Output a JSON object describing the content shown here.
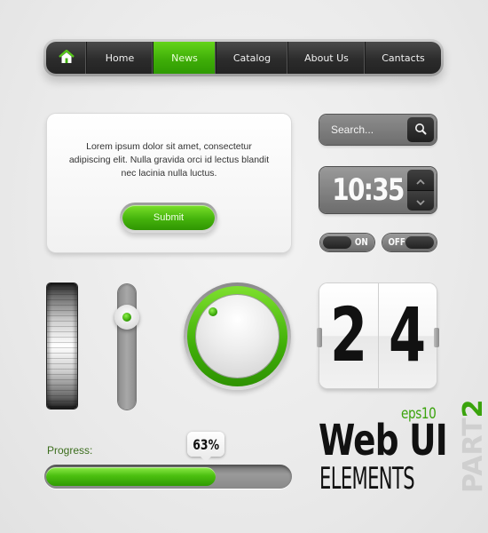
{
  "nav": {
    "home_icon": "home-icon",
    "items": [
      {
        "label": "Home",
        "active": false
      },
      {
        "label": "News",
        "active": true
      },
      {
        "label": "Catalog",
        "active": false
      },
      {
        "label": "About Us",
        "active": false
      },
      {
        "label": "Cantacts",
        "active": false
      }
    ]
  },
  "card": {
    "text": "Lorem ipsum dolor sit amet, consectetur adipiscing elit. Nulla gravida orci id lectus blandit nec lacinia nulla luctus.",
    "submit_label": "Submit"
  },
  "search": {
    "placeholder": "Search...",
    "value": "",
    "icon": "search-icon"
  },
  "clock": {
    "time": "10:35",
    "up_icon": "chevron-up-icon",
    "down_icon": "chevron-down-icon"
  },
  "toggles": {
    "on_label": "ON",
    "off_label": "OFF"
  },
  "slider": {
    "value_fraction": 0.2
  },
  "knob": {
    "angle_deg": -45
  },
  "flip_counter": {
    "digits": [
      "2",
      "4"
    ]
  },
  "progress": {
    "label": "Progress:",
    "value_text": "63%",
    "value_percent": 63
  },
  "branding": {
    "eps": "eps10",
    "title_line1": "Web UI",
    "title_line2": "ELEMENTS",
    "part_word": "PART",
    "part_number": "2"
  },
  "colors": {
    "accent_green": "#3fae08",
    "dark": "#2c2c2c",
    "background": "#ececec"
  }
}
